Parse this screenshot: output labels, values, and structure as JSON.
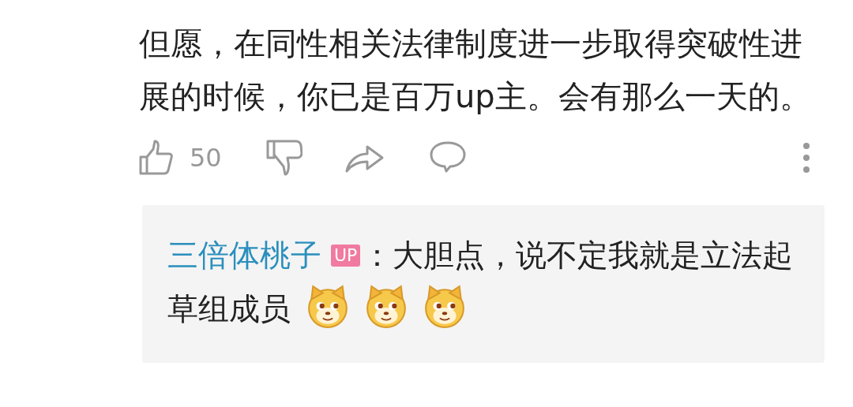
{
  "comment": {
    "text": "但愿，在同性相关法律制度进一步取得突破性进展的时候，你已是百万up主。会有那么一天的。"
  },
  "actions": {
    "like_count": "50"
  },
  "reply": {
    "author": "三倍体桃子",
    "badge": "UP",
    "text": "：大胆点，说不定我就是立法起草组成员",
    "emojis": [
      {
        "kind": "dog"
      },
      {
        "kind": "dog"
      },
      {
        "kind": "dog"
      }
    ]
  }
}
